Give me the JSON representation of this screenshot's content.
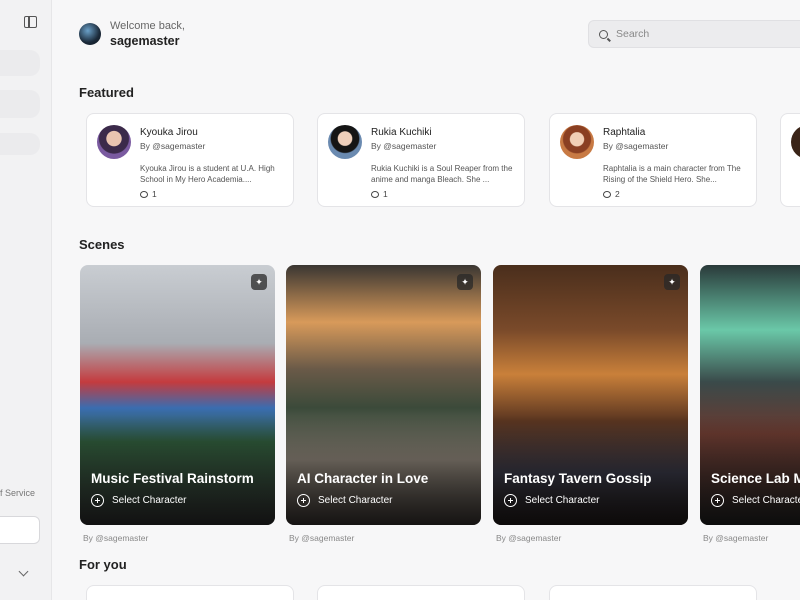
{
  "user": {
    "greeting": "Welcome back,",
    "username": "sagemaster"
  },
  "search": {
    "placeholder": "Search",
    "value": ""
  },
  "sidebar": {
    "footer_link": "f Service"
  },
  "sections": {
    "featured": "Featured",
    "scenes": "Scenes",
    "for_you": "For you"
  },
  "featured": [
    {
      "name": "Kyouka Jirou",
      "by": "By @sagemaster",
      "description": "Kyouka Jirou is a student at U.A. High School in My Hero Academia....",
      "count": "1"
    },
    {
      "name": "Rukia Kuchiki",
      "by": "By @sagemaster",
      "description": "Rukia Kuchiki is a Soul Reaper from the anime and manga Bleach. She ...",
      "count": "1"
    },
    {
      "name": "Raphtalia",
      "by": "By @sagemaster",
      "description": "Raphtalia is a main character from The Rising of the Shield Hero. She...",
      "count": "2"
    }
  ],
  "scenes": [
    {
      "title": "Music Festival Rainstorm",
      "action": "Select Character",
      "by": "By @sagemaster"
    },
    {
      "title": "AI Character in Love",
      "action": "Select Character",
      "by": "By @sagemaster"
    },
    {
      "title": "Fantasy Tavern Gossip",
      "action": "Select Character",
      "by": "By @sagemaster"
    },
    {
      "title": "Science Lab M",
      "action": "Select Characte",
      "by": "By @sagemaster"
    }
  ],
  "colors": {
    "background": "#f7f7f8",
    "card_border": "#e4e4e7",
    "text_primary": "#222222"
  },
  "icons": {
    "sidebar_toggle": "sidebar-toggle-icon",
    "search": "search-icon",
    "comment": "comment-icon",
    "sparkle": "sparkle-icon",
    "add": "add-circle-icon",
    "chevron": "chevron-down-icon"
  }
}
